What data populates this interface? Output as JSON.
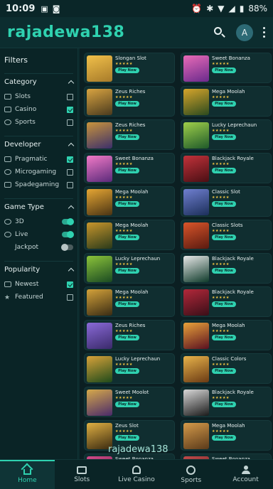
{
  "status": {
    "time": "10:09",
    "battery": "88%"
  },
  "app": {
    "brand": "rajadewa138",
    "avatar_letter": "A"
  },
  "sidebar": {
    "title": "Filters",
    "category": {
      "title": "Category",
      "items": [
        "Slots",
        "Casino",
        "Sports"
      ]
    },
    "developer": {
      "title": "Developer",
      "items": [
        "Pragmatic",
        "Microgaming",
        "Spadegaming"
      ]
    },
    "game_type": {
      "title": "Game Type",
      "items": [
        "3D",
        "Live",
        "Jackpot"
      ]
    },
    "popularity": {
      "title": "Popularity",
      "items": [
        "Newest",
        "Featured"
      ]
    }
  },
  "games": [
    {
      "name": "Slongan Slot",
      "theme": [
        "#a77b2a",
        "#f1c04a"
      ]
    },
    {
      "name": "Sweet Bonanza",
      "theme": [
        "#6a2a8c",
        "#e86bb7"
      ]
    },
    {
      "name": "Zeus Riches",
      "theme": [
        "#4a3a1e",
        "#d9a441"
      ]
    },
    {
      "name": "Mega Moolah",
      "theme": [
        "#2c4a1e",
        "#d6a52b"
      ]
    },
    {
      "name": "Zeus Riches",
      "theme": [
        "#3b2f6a",
        "#c9943c"
      ]
    },
    {
      "name": "Lucky Leprechaun",
      "theme": [
        "#1f5a2a",
        "#9fd04a"
      ]
    },
    {
      "name": "Sweet Bonanza",
      "theme": [
        "#5a2a7a",
        "#f27ac7"
      ]
    },
    {
      "name": "Blackjack Royale",
      "theme": [
        "#4a0f14",
        "#c2323a"
      ]
    },
    {
      "name": "Mega Moolah",
      "theme": [
        "#4a3414",
        "#e6a633"
      ]
    },
    {
      "name": "Classic Slot",
      "theme": [
        "#1c2f5a",
        "#6f7fd0"
      ]
    },
    {
      "name": "Mega Moolah",
      "theme": [
        "#2a3a1a",
        "#c8962c"
      ]
    },
    {
      "name": "Classic Slots",
      "theme": [
        "#5a1a10",
        "#d9552a"
      ]
    },
    {
      "name": "Lucky Leprechaun",
      "theme": [
        "#1a4a22",
        "#8cc43a"
      ]
    },
    {
      "name": "Blackjack Royale",
      "theme": [
        "#0e3a2a",
        "#e8e8e8"
      ]
    },
    {
      "name": "Mega Moolah",
      "theme": [
        "#3a2c14",
        "#d4a23a"
      ]
    },
    {
      "name": "Blackjack Royale",
      "theme": [
        "#3a0f18",
        "#b2283a"
      ]
    },
    {
      "name": "Zeus Riches",
      "theme": [
        "#3a2a6a",
        "#8a6ad8"
      ]
    },
    {
      "name": "Mega Moolah",
      "theme": [
        "#5a1020",
        "#e8a23a"
      ]
    },
    {
      "name": "Lucky Leprechaun",
      "theme": [
        "#1e4a1a",
        "#d8a23a"
      ]
    },
    {
      "name": "Classic Colors",
      "theme": [
        "#6a3a14",
        "#e8b34a"
      ]
    },
    {
      "name": "Sweet Moolot",
      "theme": [
        "#4a2a6a",
        "#d6a94a"
      ]
    },
    {
      "name": "Blackjack Royale",
      "theme": [
        "#1a1a1a",
        "#d8d8d8"
      ]
    },
    {
      "name": "Zeus Slot",
      "theme": [
        "#3a2a10",
        "#e0b043"
      ]
    },
    {
      "name": "Mega Moolah",
      "theme": [
        "#5a3a1a",
        "#d49a4a"
      ]
    },
    {
      "name": "Sweet Bonanza",
      "theme": [
        "#5a1a3a",
        "#d44a8a"
      ]
    },
    {
      "name": "Sweet Bonanza",
      "theme": [
        "#5a1a1a",
        "#c04a4a"
      ]
    }
  ],
  "play_label": "Play Now",
  "star_string": "★★★★★",
  "watermark": "rajadewa138",
  "nav": [
    "Home",
    "Slots",
    "Live Casino",
    "Sports",
    "Account"
  ],
  "colors": {
    "accent": "#2fd2b0",
    "background": "#0b2a2c",
    "star": "#f2c542"
  }
}
